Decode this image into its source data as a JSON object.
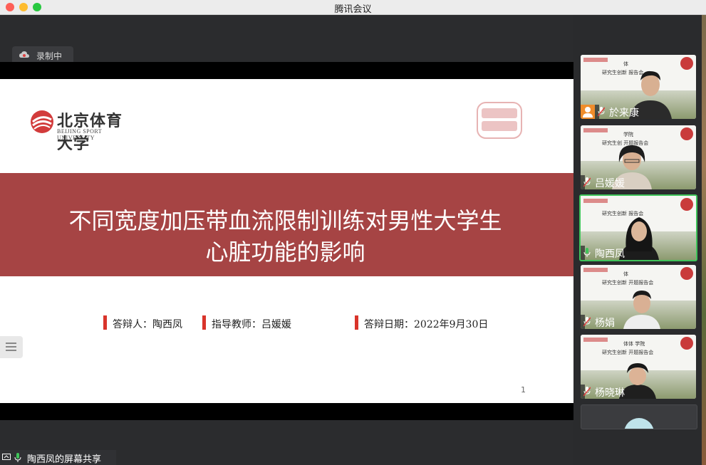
{
  "window": {
    "title": "腾讯会议"
  },
  "recording": {
    "label": "录制中"
  },
  "slide": {
    "logo_cn": "北京体育大学",
    "logo_en": "BEIJING SPORT UNIVERSITY",
    "title_line1": "不同宽度加压带血流限制训练对男性大学生",
    "title_line2": "心脏功能的影响",
    "defender": "答辩人：陶西凤",
    "advisor": "指导教师：吕媛媛",
    "date": "答辩日期：2022年9月30日",
    "page_number": "1"
  },
  "share_bar": {
    "label": "陶西凤的屏幕共享"
  },
  "participants": [
    {
      "name": "於来康",
      "active": false,
      "poster_line1": "体",
      "poster_line2": "研究生创新 报告会"
    },
    {
      "name": "吕媛媛",
      "active": false,
      "poster_line1": "学院",
      "poster_line2": "研究生创 开题报告会"
    },
    {
      "name": "陶西凤",
      "active": true,
      "poster_line1": "",
      "poster_line2": "研究生创新 报告会"
    },
    {
      "name": "杨娟",
      "active": false,
      "poster_line1": "体",
      "poster_line2": "研究生创新 开题报告会"
    },
    {
      "name": "杨晓琳",
      "active": false,
      "poster_line1": "体体 学院",
      "poster_line2": "研究生创新 开题报告会"
    }
  ],
  "colors": {
    "active_border": "#3fc45a",
    "title_band": "#a64444",
    "info_bar": "#d9342b"
  }
}
